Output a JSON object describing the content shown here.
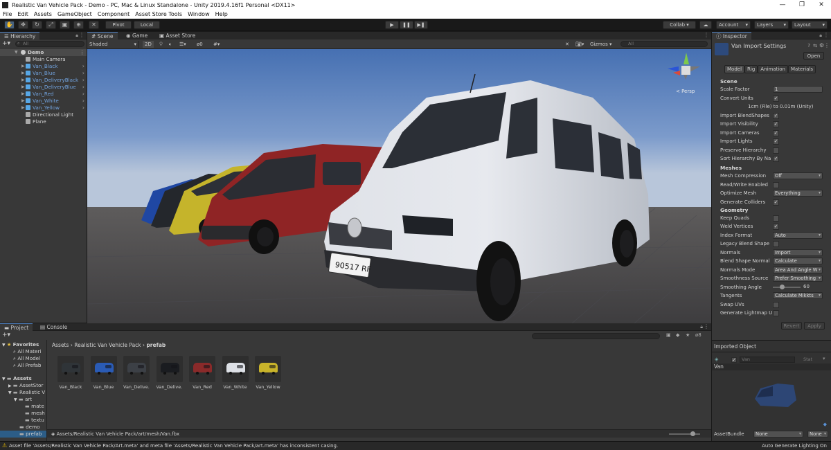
{
  "window": {
    "title": "Realistic Van Vehicle Pack - Demo - PC, Mac & Linux Standalone - Unity 2019.4.16f1 Personal <DX11>",
    "min": "—",
    "max": "❐",
    "close": "✕"
  },
  "menu": [
    "File",
    "Edit",
    "Assets",
    "GameObject",
    "Component",
    "Asset Store Tools",
    "Window",
    "Help"
  ],
  "toolbar": {
    "pivot": "Pivot",
    "local": "Local",
    "collab": "Collab ▾",
    "account": "Account",
    "layers": "Layers",
    "layout": "Layout"
  },
  "hierarchy": {
    "tab": "Hierarchy",
    "search_placeholder": "All",
    "scene": "Demo",
    "items": [
      {
        "label": "Main Camera",
        "type": "go"
      },
      {
        "label": "Van_Black",
        "type": "prefab"
      },
      {
        "label": "Van_Blue",
        "type": "prefab"
      },
      {
        "label": "Van_DeliveryBlack",
        "type": "prefab"
      },
      {
        "label": "Van_DeliveryBlue",
        "type": "prefab"
      },
      {
        "label": "Van_Red",
        "type": "prefab"
      },
      {
        "label": "Van_White",
        "type": "prefab"
      },
      {
        "label": "Van_Yellow",
        "type": "prefab"
      },
      {
        "label": "Directional Light",
        "type": "go"
      },
      {
        "label": "Plane",
        "type": "go"
      }
    ]
  },
  "scene_tabs": {
    "scene": "Scene",
    "game": "Game",
    "store": "Asset Store",
    "shading": "Shaded",
    "mode_2d": "2D",
    "hidden_count": "0",
    "gizmos": "Gizmos",
    "search_placeholder": "All",
    "persp": "< Persp"
  },
  "scene_plate": "90517 RF",
  "inspector": {
    "tab": "Inspector",
    "title": "Van Import Settings",
    "open": "Open",
    "tabs": [
      "Model",
      "Rig",
      "Animation",
      "Materials"
    ],
    "scene_header": "Scene",
    "scale_factor_label": "Scale Factor",
    "scale_factor": "1",
    "convert_units_label": "Convert Units",
    "convert_note": "1cm (File) to 0.01m (Unity)",
    "import_blendshapes": "Import BlendShapes",
    "import_visibility": "Import Visibility",
    "import_cameras": "Import Cameras",
    "import_lights": "Import Lights",
    "preserve_hierarchy": "Preserve Hierarchy",
    "sort_hierarchy": "Sort Hierarchy By Na",
    "meshes_header": "Meshes",
    "mesh_compression_label": "Mesh Compression",
    "mesh_compression": "Off",
    "read_write": "Read/Write Enabled",
    "optimize_mesh_label": "Optimize Mesh",
    "optimize_mesh": "Everything",
    "generate_colliders": "Generate Colliders",
    "geometry_header": "Geometry",
    "keep_quads": "Keep Quads",
    "weld_vertices": "Weld Vertices",
    "index_format_label": "Index Format",
    "index_format": "Auto",
    "legacy_blend": "Legacy Blend Shape",
    "normals_label": "Normals",
    "normals": "Import",
    "blend_shape_normals_label": "Blend Shape Normal",
    "blend_shape_normals": "Calculate",
    "normals_mode_label": "Normals Mode",
    "normals_mode": "Area And Angle W",
    "smoothness_source_label": "Smoothness Source",
    "smoothness_source": "Prefer Smoothing",
    "smoothing_angle_label": "Smoothing Angle",
    "smoothing_angle": "60",
    "smoothing_angle_fraction": 0.33,
    "tangents_label": "Tangents",
    "tangents": "Calculate Mikkts",
    "swap_uvs": "Swap UVs",
    "gen_lightmap": "Generate Lightmap U",
    "revert": "Revert",
    "apply": "Apply",
    "imported_object": "Imported Object",
    "preview_name": "Van",
    "preview_field": "Van",
    "preview_static": "Stat",
    "asset_bundle_label": "AssetBundle",
    "asset_bundle": "None",
    "asset_bundle_variant": "None"
  },
  "project": {
    "tab_project": "Project",
    "tab_console": "Console",
    "favorites": "Favorites",
    "fav_items": [
      "All Materi",
      "All Model",
      "All Prefab"
    ],
    "assets": "Assets",
    "tree": [
      "AssetStor",
      "Realistic V",
      "art",
      "mate",
      "mesh",
      "textu",
      "demo",
      "prefab"
    ],
    "breadcrumb": [
      "Assets",
      "Realistic Van Vehicle Pack",
      "prefab"
    ],
    "item_count": "8",
    "items": [
      {
        "label": "Van_Black",
        "color": "#2f3438"
      },
      {
        "label": "Van_Blue",
        "color": "#2a5bb5"
      },
      {
        "label": "Van_Delive...",
        "color": "#3c4046"
      },
      {
        "label": "Van_Delive...",
        "color": "#1a1c20"
      },
      {
        "label": "Van_Red",
        "color": "#8a2a2a"
      },
      {
        "label": "Van_White",
        "color": "#dde0e6"
      },
      {
        "label": "Van_Yellow",
        "color": "#c8b32a"
      }
    ],
    "path": "Assets/Realistic Van Vehicle Pack/art/mesh/Van.fbx"
  },
  "status": {
    "warning": "Asset file 'Assets/Realistic Van Vehicle Pack/Art.meta' and meta file 'Assets/Realistic Van Vehicle Pack/art.meta' has inconsistent casing.",
    "lighting": "Auto Generate Lighting On"
  },
  "colors": {
    "accent": "#4f82c4",
    "prefab_text": "#72a4e0",
    "panel": "#383838",
    "warning": "#e6b800"
  }
}
